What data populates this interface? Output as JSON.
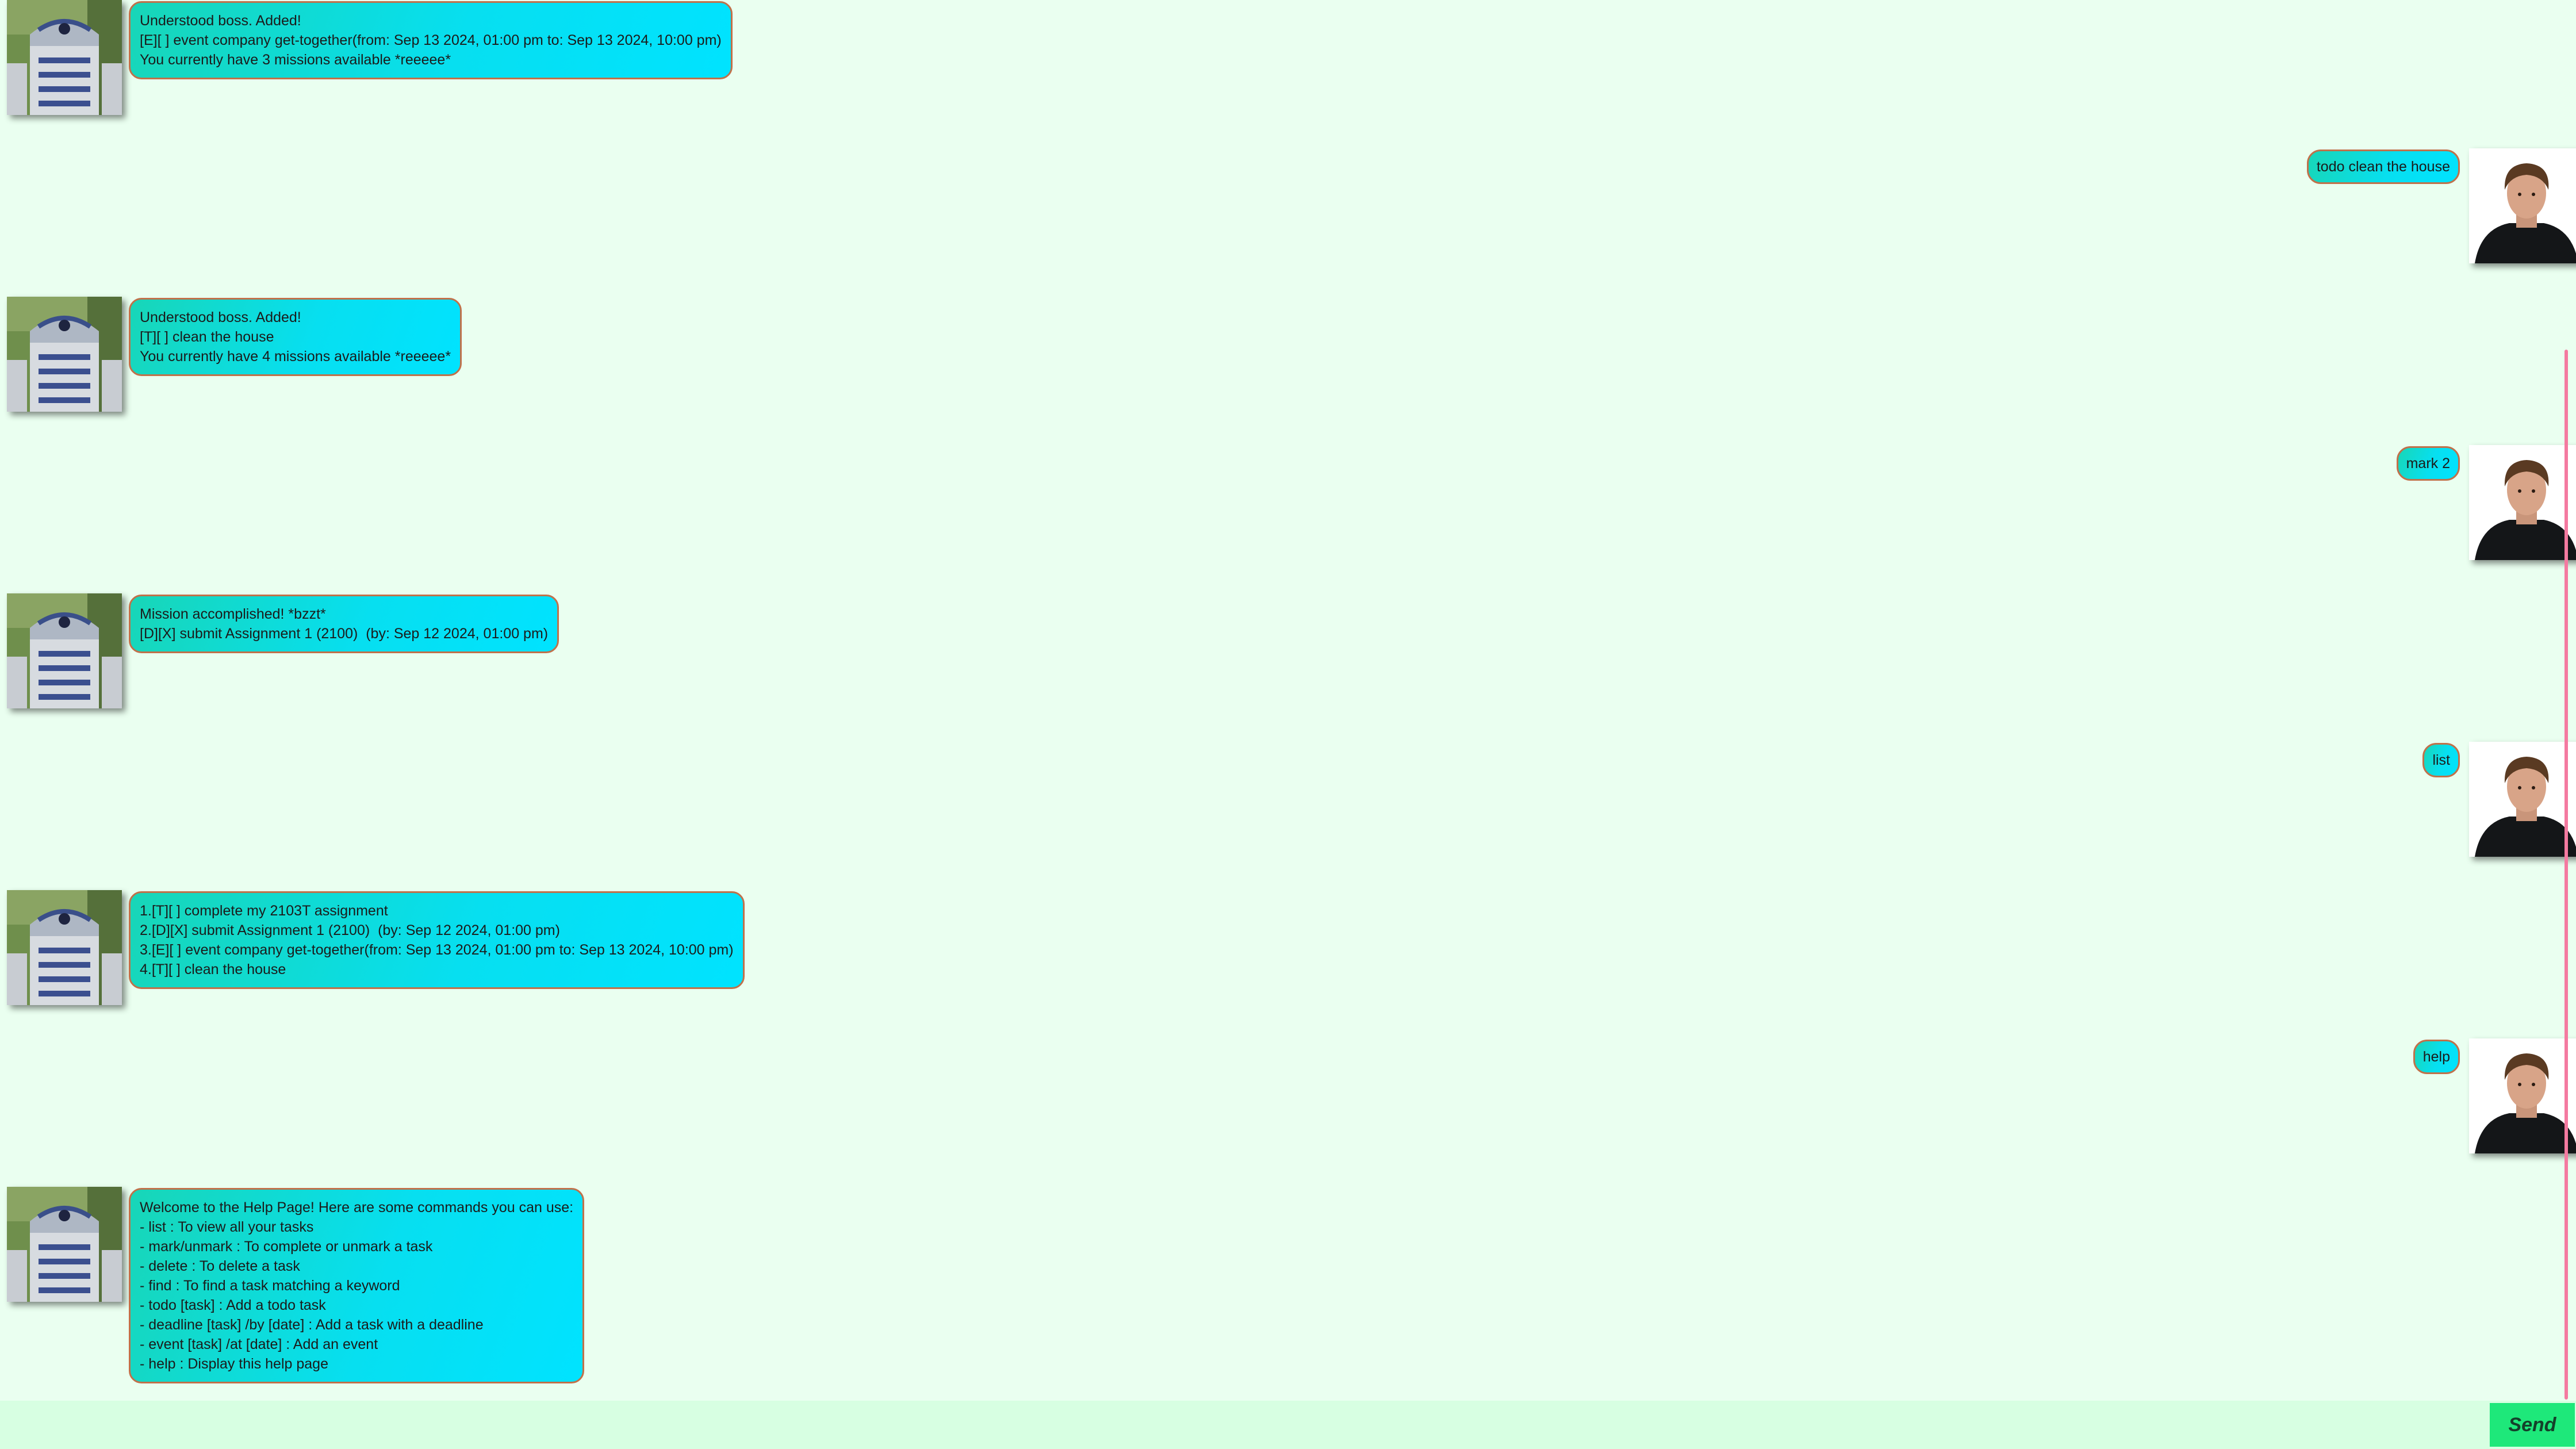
{
  "colors": {
    "background": "#eafff0",
    "bubble_start": "#18d6b7",
    "bubble_end": "#00e3ff",
    "bubble_border": "#c0714a",
    "send_button": "#1ee87a",
    "input_bar": "#d7ffe2",
    "scrollbar": "#f47aa0"
  },
  "avatars": {
    "bot": "r2d2-avatar",
    "user": "luke-avatar"
  },
  "messages": [
    {
      "sender": "bot",
      "text": "Understood boss. Added!\n[E][ ] event company get-together(from: Sep 13 2024, 01:00 pm to: Sep 13 2024, 10:00 pm)\nYou currently have 3 missions available *reeeee*"
    },
    {
      "sender": "user",
      "text": "todo clean the house"
    },
    {
      "sender": "bot",
      "text": "Understood boss. Added!\n[T][ ] clean the house\nYou currently have 4 missions available *reeeee*"
    },
    {
      "sender": "user",
      "text": "mark 2"
    },
    {
      "sender": "bot",
      "text": "Mission accomplished! *bzzt*\n[D][X] submit Assignment 1 (2100)  (by: Sep 12 2024, 01:00 pm)"
    },
    {
      "sender": "user",
      "text": "list"
    },
    {
      "sender": "bot",
      "text": "1.[T][ ] complete my 2103T assignment\n2.[D][X] submit Assignment 1 (2100)  (by: Sep 12 2024, 01:00 pm)\n3.[E][ ] event company get-together(from: Sep 13 2024, 01:00 pm to: Sep 13 2024, 10:00 pm)\n4.[T][ ] clean the house"
    },
    {
      "sender": "user",
      "text": "help"
    },
    {
      "sender": "bot",
      "text": "Welcome to the Help Page! Here are some commands you can use:\n- list : To view all your tasks\n- mark/unmark : To complete or unmark a task\n- delete : To delete a task\n- find : To find a task matching a keyword\n- todo [task] : Add a todo task\n- deadline [task] /by [date] : Add a task with a deadline\n- event [task] /at [date] : Add an event\n- help : Display this help page"
    }
  ],
  "input": {
    "value": "",
    "placeholder": ""
  },
  "send_label": "Send"
}
